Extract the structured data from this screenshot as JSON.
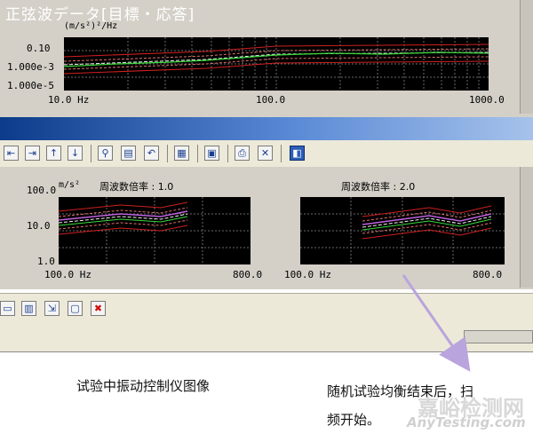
{
  "top_chart": {
    "unit": "(m/s²)²/Hz",
    "y_ticks": [
      "0.10",
      "1.000e-3",
      "1.000e-5"
    ],
    "x_ticks": [
      "10.0 Hz",
      "100.0",
      "1000.0"
    ]
  },
  "window": {
    "title": "正弦波データ[目標・応答]"
  },
  "toolbar": {
    "icons": [
      "export-icon",
      "export-alt-icon",
      "sort-up-icon",
      "sort-down-icon",
      "zoom-icon",
      "graph-settings-icon",
      "undo-icon",
      "save-icon",
      "properties-icon",
      "print-icon",
      "delete-icon",
      "display-mode-icon"
    ]
  },
  "sine_charts": [
    {
      "unit": "m/s²",
      "header": "周波数倍率 : 1.0",
      "y_ticks": [
        "100.0",
        "10.0",
        "1.0"
      ],
      "x_ticks": [
        "100.0 Hz",
        "800.0"
      ]
    },
    {
      "header": "周波数倍率 : 2.0",
      "x_ticks": [
        "100.0 Hz",
        "800.0"
      ]
    }
  ],
  "bottom_toolbar": {
    "icons": [
      "layout-icon",
      "columns-icon",
      "import-icon",
      "monitor-icon",
      "close-red-icon"
    ]
  },
  "captions": {
    "left": "试验中振动控制仪图像",
    "right_line1": "随机试验均衡结束后，扫",
    "right_line2": "频开始。"
  },
  "watermark": {
    "line1": "嘉峪检测网",
    "line2": "AnyTesting.com"
  },
  "colors": {
    "title_bar": "#0b3b8a",
    "plot_bg": "#000000",
    "arrow": "#b9a4dd"
  }
}
